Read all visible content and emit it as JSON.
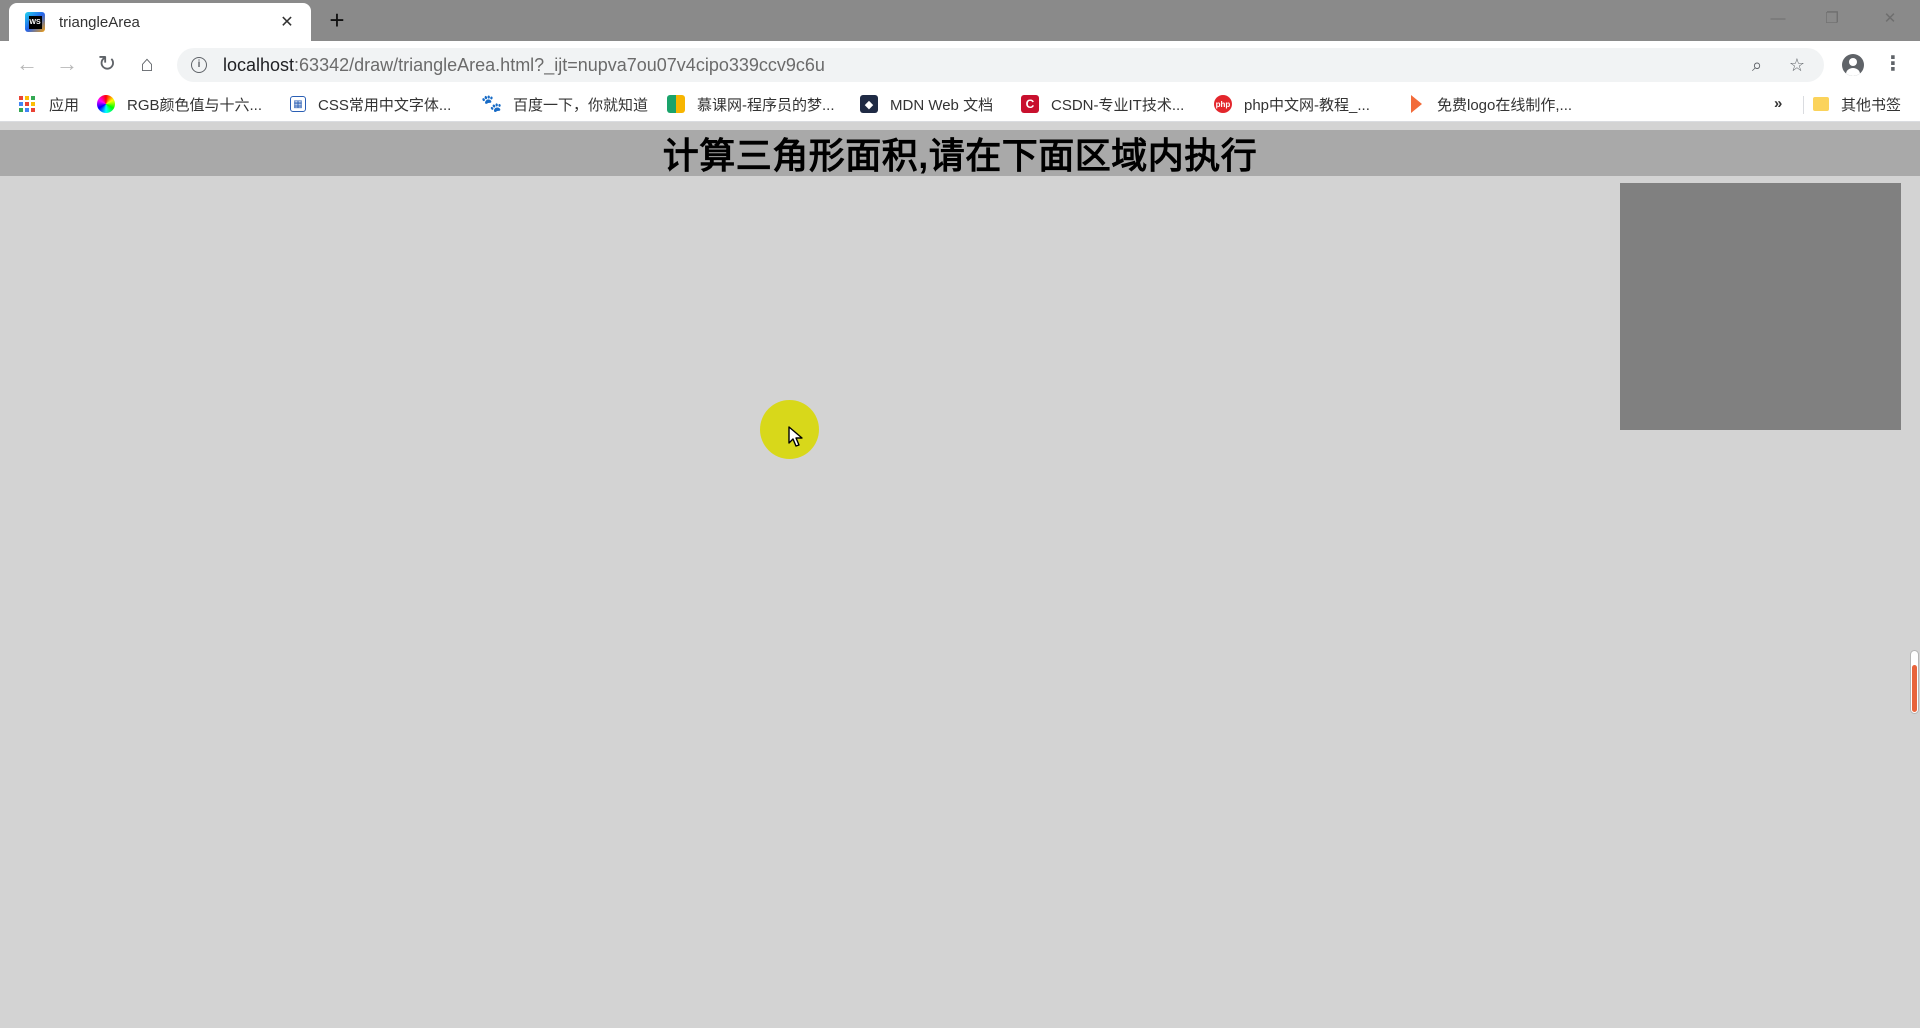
{
  "browser": {
    "tab": {
      "title": "triangleArea",
      "favicon_text": "WS"
    },
    "url": {
      "host": "localhost",
      "rest": ":63342/draw/triangleArea.html?_ijt=nupva7ou07v4cipo339ccv9c6u"
    },
    "bookmarks": [
      {
        "label": "应用",
        "icon": "apps-grid-icon"
      },
      {
        "label": "RGB颜色值与十六...",
        "icon": "rainbow-icon"
      },
      {
        "label": "CSS常用中文字体...",
        "icon": "chart-icon"
      },
      {
        "label": "百度一下，你就知道",
        "icon": "baidu-paw-icon"
      },
      {
        "label": "慕课网-程序员的梦...",
        "icon": "imooc-book-icon"
      },
      {
        "label": "MDN Web 文档",
        "icon": "mdn-dino-icon"
      },
      {
        "label": "CSDN-专业IT技术...",
        "icon": "csdn-icon"
      },
      {
        "label": "php中文网-教程_...",
        "icon": "php-icon"
      },
      {
        "label": "免费logo在线制作,...",
        "icon": "logo-arrow-icon"
      }
    ],
    "other_bookmarks": "其他书签",
    "overflow_glyph": "»"
  },
  "page": {
    "title": "计算三角形面积,请在下面区域内执行"
  },
  "colors": {
    "page_bg": "#d3d3d3",
    "header_bg": "#a9a9a9",
    "box_bg": "#808080",
    "cursor_halo": "#d8d81a",
    "tabstrip_bg": "#8a8a8a"
  }
}
